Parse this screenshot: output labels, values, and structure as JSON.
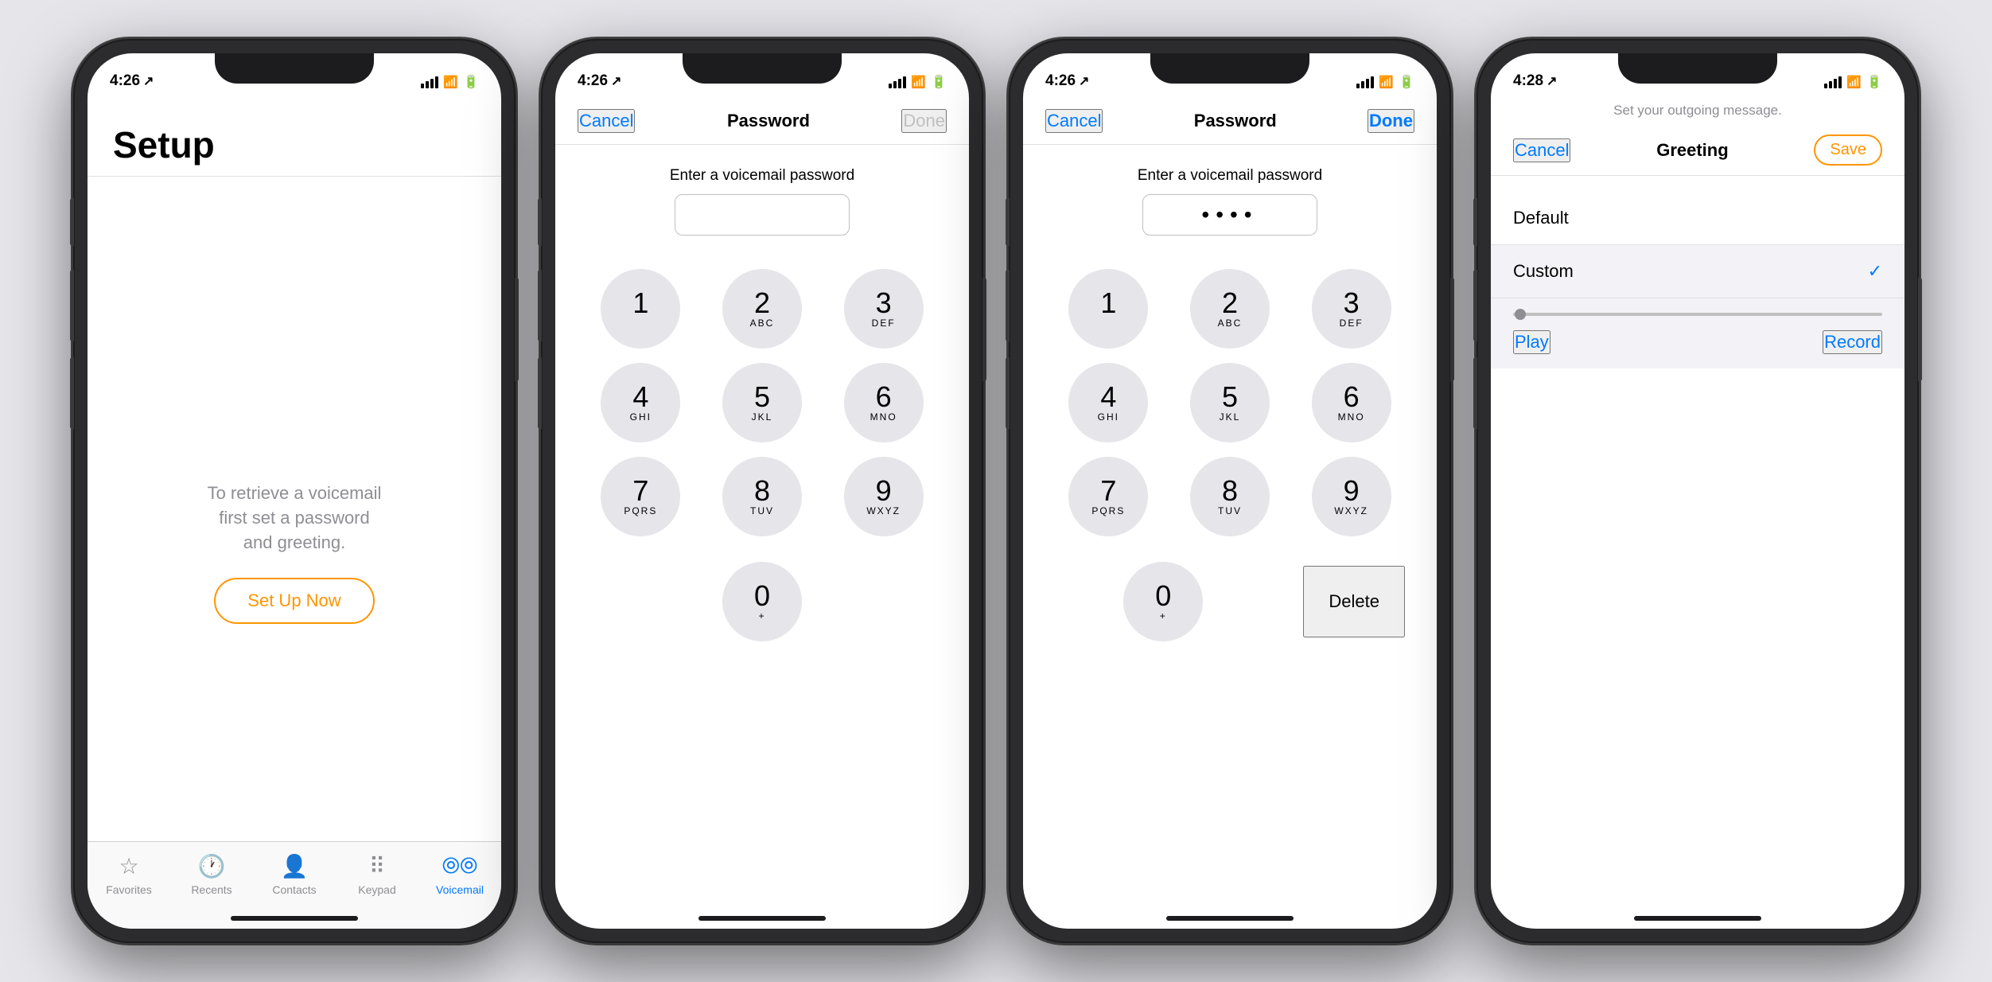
{
  "colors": {
    "orange": "#ff9500",
    "blue": "#007aff",
    "gray": "#8e8e93",
    "dark": "#1c1c1e",
    "white": "#ffffff"
  },
  "phone1": {
    "status_time": "4:26",
    "nav_icon": "↗",
    "title": "Setup",
    "description": "To retrieve a voicemail\nfirst set a password\nand greeting.",
    "setup_btn": "Set Up Now",
    "tabs": [
      {
        "icon": "★",
        "label": "Favorites",
        "active": false
      },
      {
        "icon": "🕐",
        "label": "Recents",
        "active": false
      },
      {
        "icon": "👤",
        "label": "Contacts",
        "active": false
      },
      {
        "icon": "⌨",
        "label": "Keypad",
        "active": false
      },
      {
        "icon": "∞",
        "label": "Voicemail",
        "active": true
      }
    ]
  },
  "phone2": {
    "status_time": "4:26",
    "nav_icon": "↗",
    "cancel": "Cancel",
    "title": "Password",
    "done": "Done",
    "password_label": "Enter a voicemail password",
    "password_value": "",
    "keys": [
      {
        "num": "1",
        "letters": ""
      },
      {
        "num": "2",
        "letters": "ABC"
      },
      {
        "num": "3",
        "letters": "DEF"
      },
      {
        "num": "4",
        "letters": "GHI"
      },
      {
        "num": "5",
        "letters": "JKL"
      },
      {
        "num": "6",
        "letters": "MNO"
      },
      {
        "num": "7",
        "letters": "PQRS"
      },
      {
        "num": "8",
        "letters": "TUV"
      },
      {
        "num": "9",
        "letters": "WXYZ"
      },
      {
        "num": "0",
        "letters": "+"
      }
    ]
  },
  "phone3": {
    "status_time": "4:26",
    "nav_icon": "↗",
    "cancel": "Cancel",
    "title": "Password",
    "done": "Done",
    "password_label": "Enter a voicemail password",
    "password_dots": "••••",
    "delete_label": "Delete",
    "keys": [
      {
        "num": "1",
        "letters": ""
      },
      {
        "num": "2",
        "letters": "ABC"
      },
      {
        "num": "3",
        "letters": "DEF"
      },
      {
        "num": "4",
        "letters": "GHI"
      },
      {
        "num": "5",
        "letters": "JKL"
      },
      {
        "num": "6",
        "letters": "MNO"
      },
      {
        "num": "7",
        "letters": "PQRS"
      },
      {
        "num": "8",
        "letters": "TUV"
      },
      {
        "num": "9",
        "letters": "WXYZ"
      },
      {
        "num": "0",
        "letters": "+"
      }
    ]
  },
  "phone4": {
    "status_time": "4:28",
    "nav_icon": "↗",
    "cancel": "Cancel",
    "title": "Greeting",
    "save": "Save",
    "subtitle": "Set your outgoing message.",
    "options": [
      {
        "label": "Default",
        "selected": false
      },
      {
        "label": "Custom",
        "selected": true
      }
    ],
    "play": "Play",
    "record": "Record"
  }
}
